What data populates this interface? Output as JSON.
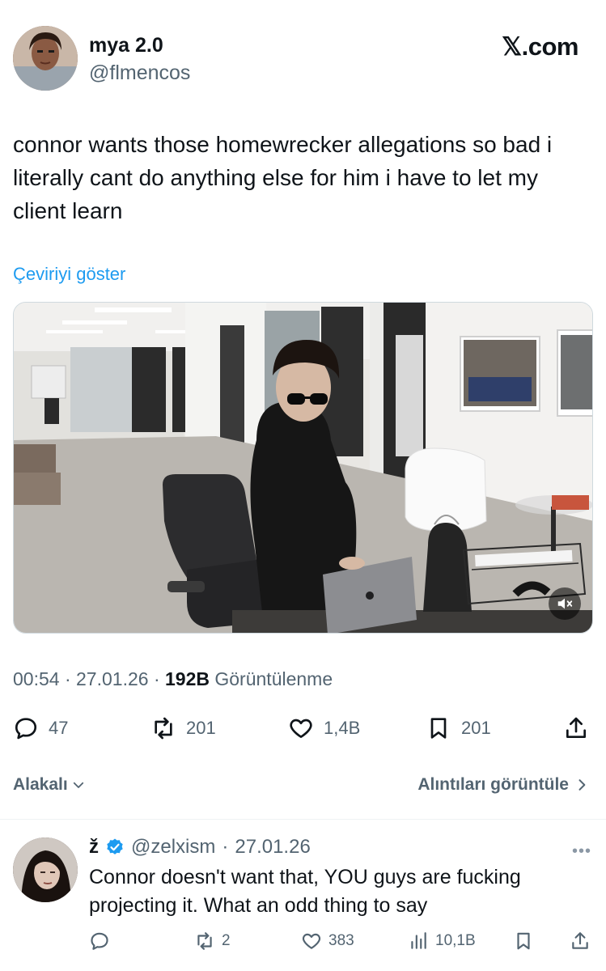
{
  "author": {
    "name": "mya 2.0",
    "handle": "@flmencos"
  },
  "brand": "𝕏.com",
  "tweet": {
    "text": "connor wants those homewrecker allegations so bad i literally cant do anything else for him i have to let my client learn",
    "translate_label": "Çeviriyi göster",
    "time": "00:54",
    "date": "27.01.26",
    "views": "192B",
    "views_label": "Görüntülenme"
  },
  "actions": {
    "replies": "47",
    "reposts": "201",
    "likes": "1,4B",
    "bookmarks": "201"
  },
  "sort": {
    "left_label": "Alakalı",
    "right_label": "Alıntıları görüntüle"
  },
  "reply": {
    "name": "ž",
    "handle": "@zelxism",
    "date": "27.01.26",
    "text": "Connor doesn't want that, YOU guys are fucking projecting it. What an odd thing to say",
    "actions": {
      "reposts": "2",
      "likes": "383",
      "views": "10,1B"
    }
  },
  "colors": {
    "link": "#1d9bf0",
    "text": "#0f1419",
    "muted": "#536471",
    "verified": "#1d9bf0"
  }
}
